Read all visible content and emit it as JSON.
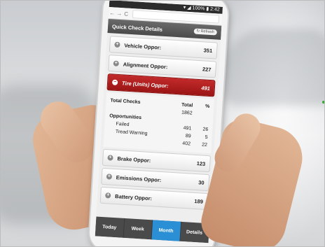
{
  "browser": {
    "status": "▾ ◢ 100% ▮ 2:42",
    "back_glyph": "←",
    "forward_glyph": "→",
    "reload_glyph": "C",
    "url": ""
  },
  "header": {
    "title": "Quick Check Details",
    "refresh_label": "↻ Refresh"
  },
  "items": [
    {
      "label": "Vehicle Oppor:",
      "value": "351",
      "icon": "+"
    },
    {
      "label": "Alignment Oppor:",
      "value": "227",
      "icon": "+"
    }
  ],
  "active_item": {
    "label": "Tire (Units) Oppor:",
    "value": "491",
    "icon": "−"
  },
  "details": {
    "col_total": "Total",
    "col_percent": "%",
    "label_line1": "Total Checks",
    "total_checks": "1862",
    "label_line2": "Opportunities",
    "rows": [
      {
        "label": "Failed",
        "total": "491",
        "percent": "26"
      },
      {
        "label": "Tread Warning",
        "total": "89",
        "percent": "5"
      },
      {
        "label": "",
        "total": "402",
        "percent": "22"
      }
    ]
  },
  "items_after": [
    {
      "label": "Brake Oppor:",
      "value": "123",
      "icon": "+"
    },
    {
      "label": "Emissions Oppor:",
      "value": "30",
      "icon": "+"
    },
    {
      "label": "Battery Oppor:",
      "value": "189",
      "icon": "+"
    }
  ],
  "tabs": [
    {
      "label": "Today",
      "active": false
    },
    {
      "label": "Week",
      "active": false
    },
    {
      "label": "Month",
      "active": true
    },
    {
      "label": "Details",
      "active": false
    }
  ],
  "colors": {
    "active_row": "#b41d1d",
    "active_tab": "#2b8fd6",
    "header": "#555555",
    "tab_bar": "#4a4a4a"
  }
}
